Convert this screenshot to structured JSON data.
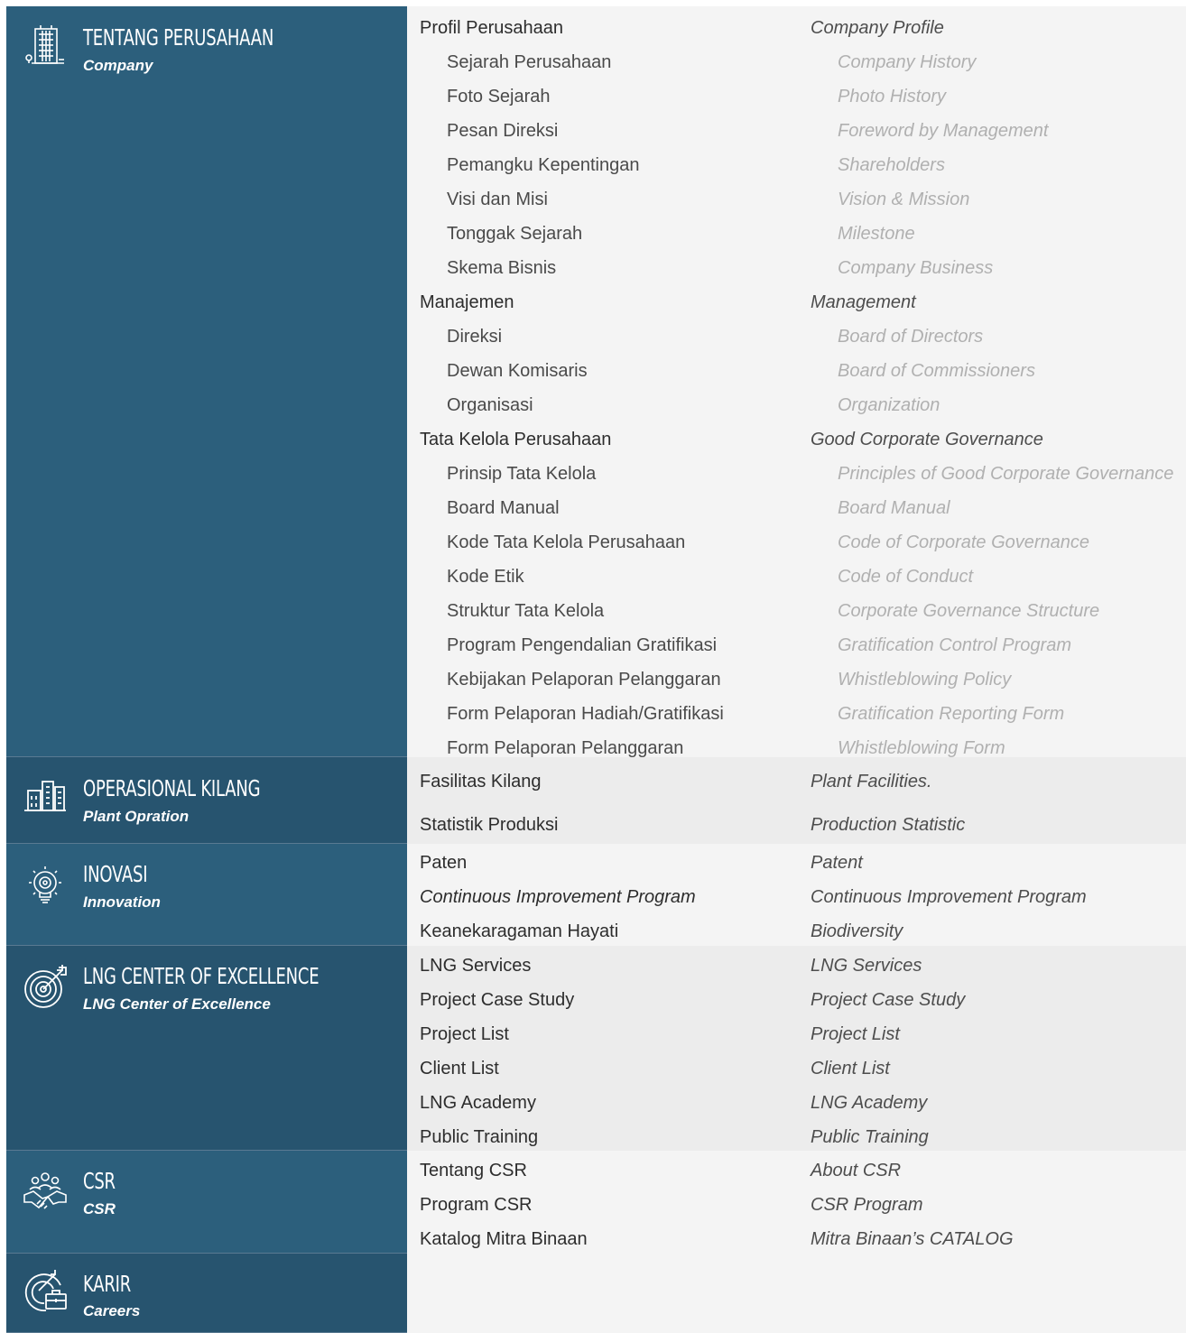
{
  "colors": {
    "panel": "#2c5f7c",
    "panel_dark": "#27546f",
    "row_light": "#f4f4f4",
    "row_mid": "#ececec"
  },
  "sections": [
    {
      "id": "company",
      "title": "TENTANG PERUSAHAAN",
      "subtitle": "Company",
      "icon": "building-icon",
      "rows": [
        {
          "id": "Profil Perusahaan",
          "en": "Company Profile",
          "level": 1
        },
        {
          "id": "Sejarah Perusahaan",
          "en": "Company History",
          "level": 2
        },
        {
          "id": "Foto Sejarah",
          "en": "Photo History",
          "level": 2
        },
        {
          "id": "Pesan Direksi",
          "en": "Foreword by Management",
          "level": 2
        },
        {
          "id": "Pemangku Kepentingan",
          "en": "Shareholders",
          "level": 2
        },
        {
          "id": "Visi dan Misi",
          "en": "Vision & Mission",
          "level": 2
        },
        {
          "id": "Tonggak Sejarah",
          "en": "Milestone",
          "level": 2
        },
        {
          "id": "Skema Bisnis",
          "en": "Company Business",
          "level": 2
        },
        {
          "id": "Manajemen",
          "en": "Management",
          "level": 1
        },
        {
          "id": "Direksi",
          "en": "Board of Directors",
          "level": 2
        },
        {
          "id": "Dewan Komisaris",
          "en": "Board of Commissioners",
          "level": 2
        },
        {
          "id": "Organisasi",
          "en": "Organization",
          "level": 2
        },
        {
          "id": "Tata Kelola Perusahaan",
          "en": "Good Corporate Governance",
          "level": 1
        },
        {
          "id": "Prinsip Tata Kelola",
          "en": "Principles of Good Corporate Governance",
          "level": 2
        },
        {
          "id": "Board Manual",
          "en": "Board Manual",
          "level": 2
        },
        {
          "id": "Kode Tata Kelola Perusahaan",
          "en": "Code of Corporate Governance",
          "level": 2
        },
        {
          "id": "Kode Etik",
          "en": "Code of Conduct",
          "level": 2
        },
        {
          "id": "Struktur Tata Kelola",
          "en": "Corporate Governance Structure",
          "level": 2
        },
        {
          "id": "Program Pengendalian Gratifikasi",
          "en": "Gratification Control Program",
          "level": 2
        },
        {
          "id": "Kebijakan Pelaporan Pelanggaran",
          "en": "Whistleblowing Policy",
          "level": 2
        },
        {
          "id": "Form Pelaporan Hadiah/Gratifikasi",
          "en": "Gratification Reporting Form",
          "level": 2
        },
        {
          "id": "Form Pelaporan Pelanggaran",
          "en": "Whistleblowing Form",
          "level": 2
        }
      ]
    },
    {
      "id": "plant",
      "title": "OPERASIONAL KILANG",
      "subtitle": "Plant Opration",
      "icon": "plant-buildings-icon",
      "rows": [
        {
          "id": "Fasilitas Kilang",
          "en": "Plant Facilities.",
          "level": 1
        },
        {
          "id": "Statistik Produksi",
          "en": "Production Statistic",
          "level": 1
        }
      ]
    },
    {
      "id": "innovation",
      "title": "INOVASI",
      "subtitle": "Innovation",
      "icon": "lightbulb-gear-icon",
      "rows": [
        {
          "id": "Paten",
          "en": "Patent",
          "level": 1
        },
        {
          "id": "Continuous Improvement Program",
          "en": "Continuous Improvement Program",
          "level": 1,
          "italic": true
        },
        {
          "id": "Keanekaragaman Hayati",
          "en": "Biodiversity",
          "level": 1
        }
      ]
    },
    {
      "id": "lng",
      "title": "LNG CENTER OF EXCELLENCE",
      "subtitle": "LNG Center of Excellence",
      "icon": "target-icon",
      "rows": [
        {
          "id": "LNG Services",
          "en": "LNG Services",
          "level": 1
        },
        {
          "id": "Project Case Study",
          "en": "Project Case Study",
          "level": 1
        },
        {
          "id": "Project List",
          "en": "Project List",
          "level": 1
        },
        {
          "id": "Client List",
          "en": "Client List",
          "level": 1
        },
        {
          "id": "LNG Academy",
          "en": "LNG Academy",
          "level": 1
        },
        {
          "id": "Public Training",
          "en": "Public Training",
          "level": 1
        }
      ]
    },
    {
      "id": "csr",
      "title": "CSR",
      "subtitle": "CSR",
      "icon": "handshake-community-icon",
      "rows": [
        {
          "id": "Tentang CSR",
          "en": "About CSR",
          "level": 1
        },
        {
          "id": "Program CSR",
          "en": "CSR Program",
          "level": 1
        },
        {
          "id": "Katalog Mitra Binaan",
          "en": "Mitra Binaan’s CATALOG",
          "level": 1
        }
      ]
    },
    {
      "id": "career",
      "title": "KARIR",
      "subtitle": "Careers",
      "icon": "briefcase-target-icon",
      "rows": []
    }
  ]
}
